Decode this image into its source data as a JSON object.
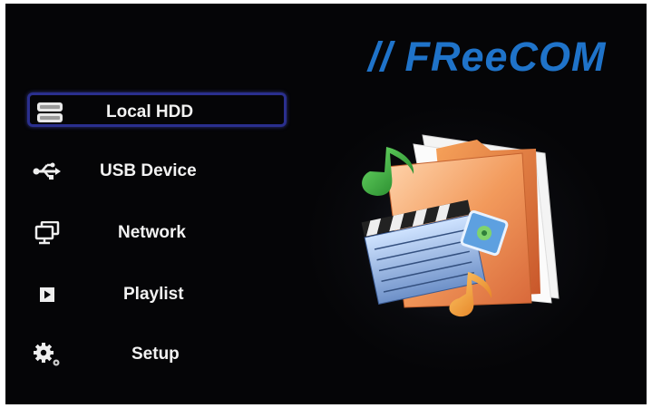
{
  "brand": {
    "logo_text": "// FReeCOM",
    "logo_color": "#1f73c9"
  },
  "menu": {
    "items": [
      {
        "label": "Local HDD",
        "icon": "hdd-icon",
        "selected": true
      },
      {
        "label": "USB Device",
        "icon": "usb-icon",
        "selected": false
      },
      {
        "label": "Network",
        "icon": "network-icon",
        "selected": false
      },
      {
        "label": "Playlist",
        "icon": "playlist-icon",
        "selected": false
      },
      {
        "label": "Setup",
        "icon": "gear-icon",
        "selected": false
      }
    ]
  },
  "colors": {
    "background": "#050507",
    "selection_border": "#2a2f8e",
    "text": "#f2f2f2"
  }
}
